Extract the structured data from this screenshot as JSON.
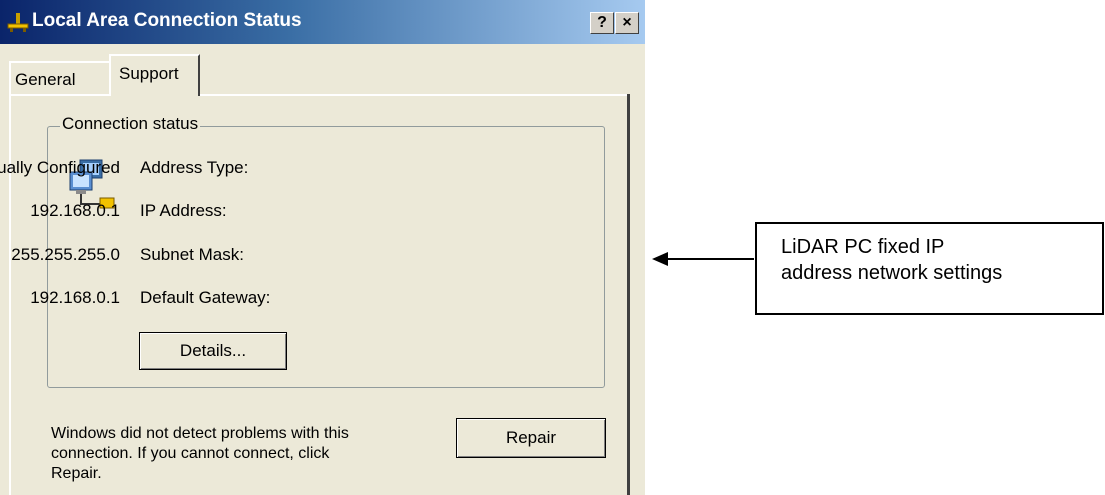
{
  "window": {
    "title": "Local Area Connection Status",
    "help_label": "?",
    "close_label": "×"
  },
  "tabs": [
    {
      "label": "General"
    },
    {
      "label": "Support"
    }
  ],
  "connection_status": {
    "group_label": "Connection status",
    "fields": [
      {
        "label": "Address Type:",
        "value": "Manually Configured"
      },
      {
        "label": "IP Address:",
        "value": "192.168.0.1"
      },
      {
        "label": "Subnet Mask:",
        "value": "255.255.255.0"
      },
      {
        "label": "Default Gateway:",
        "value": "192.168.0.1"
      }
    ],
    "details_button": "Details..."
  },
  "footer": {
    "message_lines": [
      "Windows did not detect problems with this",
      "connection. If you cannot connect, click",
      "Repair."
    ],
    "repair_button": "Repair"
  },
  "annotation": {
    "lines": [
      "LiDAR PC fixed IP",
      "address network settings"
    ]
  },
  "icons": {
    "title": "network-connection-icon",
    "status": "network-computers-icon",
    "arrow": "left-arrow-icon"
  }
}
